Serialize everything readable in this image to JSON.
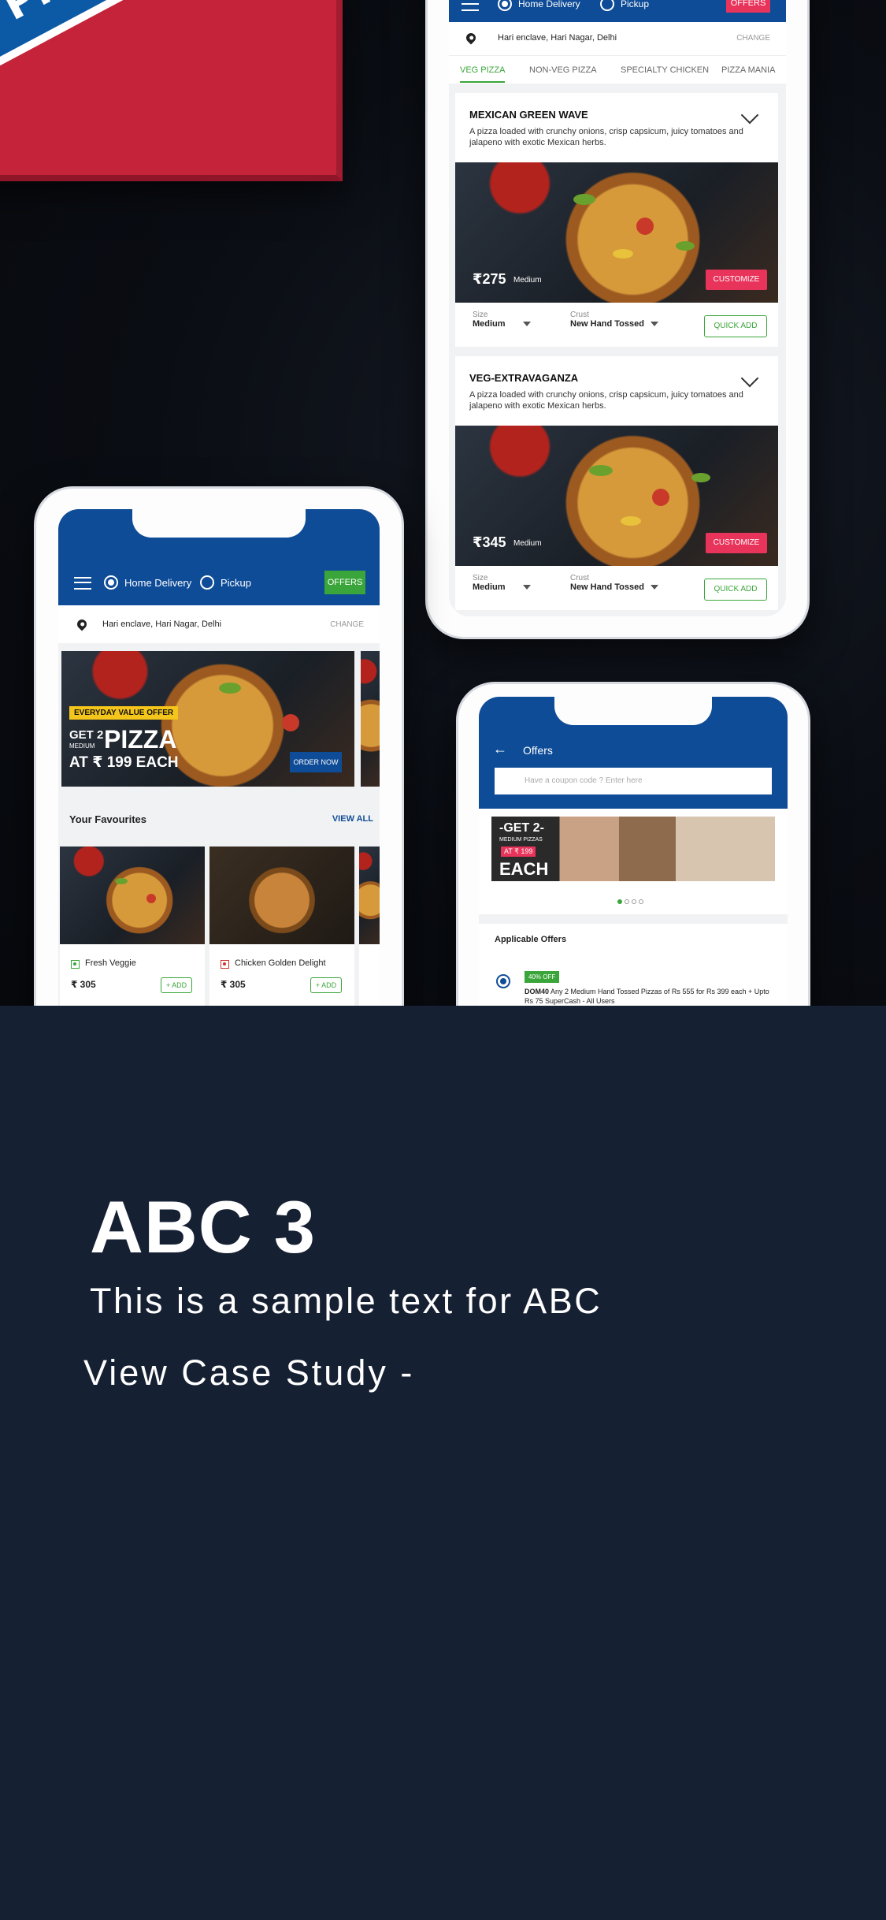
{
  "brand_box_text": "Pizz",
  "top_phone": {
    "delivery_label": "Home Delivery",
    "pickup_label": "Pickup",
    "offers_label": "OFFERS",
    "address": "Hari enclave, Hari Nagar, Delhi",
    "change_label": "CHANGE",
    "tabs": [
      "VEG PIZZA",
      "NON-VEG PIZZA",
      "SPECIALTY CHICKEN",
      "PIZZA MANIA"
    ],
    "products": [
      {
        "name": "MEXICAN GREEN WAVE",
        "desc": "A pizza loaded with crunchy onions, crisp capsicum, juicy tomatoes and jalapeno  with exotic Mexican herbs.",
        "price": "₹275",
        "size_tag": "Medium",
        "customize": "CUSTOMIZE",
        "size_label": "Size",
        "size_value": "Medium",
        "crust_label": "Crust",
        "crust_value": "New Hand Tossed",
        "quick_add": "QUICK ADD"
      },
      {
        "name": "VEG-EXTRAVAGANZA",
        "desc": "A pizza loaded with crunchy onions, crisp capsicum, juicy tomatoes and jalapeno  with exotic Mexican herbs.",
        "price": "₹345",
        "size_tag": "Medium",
        "customize": "CUSTOMIZE",
        "size_label": "Size",
        "size_value": "Medium",
        "crust_label": "Crust",
        "crust_value": "New Hand Tossed",
        "quick_add": "QUICK ADD"
      }
    ]
  },
  "left_phone": {
    "delivery_label": "Home Delivery",
    "pickup_label": "Pickup",
    "offers_label": "OFFERS",
    "address": "Hari enclave, Hari Nagar, Delhi",
    "change_label": "CHANGE",
    "banner": {
      "tag": "EVERYDAY VALUE OFFER",
      "line1": "GET 2",
      "line1b": "MEDIUM",
      "big": "PIZZA",
      "line2": "AT ₹ 199 EACH",
      "cta": "ORDER NOW"
    },
    "favourites_title": "Your Favourites",
    "view_all": "VIEW ALL",
    "items": [
      {
        "name": "Fresh Veggie",
        "price": "₹ 305",
        "add": "+ ADD",
        "veg": true
      },
      {
        "name": "Chicken Golden Delight",
        "price": "₹ 305",
        "add": "+ ADD",
        "veg": false
      }
    ]
  },
  "right_phone": {
    "title": "Offers",
    "coupon_placeholder": "Have a coupon code ? Enter here",
    "banner_line1": "-GET 2-",
    "banner_line2": "MEDIUM PIZZAS",
    "banner_line3": "AT ₹ 199",
    "banner_line4": "EACH",
    "section_title": "Applicable Offers",
    "offer_tag": "40% OFF",
    "offer_code": "DOM40",
    "offer_text": " Any 2 Medium Hand Tossed Pizzas of Rs 555 for Rs 399 each + Upto Rs 75 SuperCash - All Users"
  },
  "card": {
    "title": "ABC 3",
    "subtitle": "This is a sample text for ABC",
    "link": "View Case Study -"
  },
  "colors": {
    "blue": "#0f4c97",
    "green": "#3aa53a",
    "pink": "#e8335a",
    "navy": "#162033"
  }
}
